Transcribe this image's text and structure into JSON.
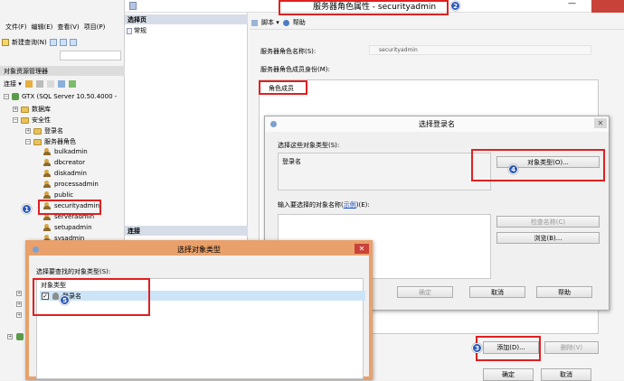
{
  "ssms": {
    "menu": [
      "文件(F)",
      "编辑(E)",
      "查看(V)",
      "项目(P)"
    ],
    "new_query": "新建查询(N)",
    "object_explorer_title": "对象资源管理器",
    "connect": "连接 ▾",
    "tree": {
      "server": "GTX (SQL Server 10.50.4000 -",
      "databases": "数据库",
      "security": "安全性",
      "logins": "登录名",
      "server_roles": "服务器角色",
      "roles": [
        "bulkadmin",
        "dbcreator",
        "diskadmin",
        "processadmin",
        "public",
        "securityadmin",
        "serveradmin",
        "setupadmin",
        "sysadmin"
      ]
    }
  },
  "role_dialog": {
    "title": "服务器角色属性 - securityadmin",
    "select_page": "选择页",
    "page_general": "常规",
    "connection": "连接",
    "toolbar": {
      "script": "脚本 ▾",
      "help": "帮助"
    },
    "role_name_label": "服务器角色名称(S):",
    "role_name_value": "securityadmin",
    "members_label": "服务器角色成员身份(M):",
    "members_header": "角色成员",
    "add": "添加(D)...",
    "remove": "删除(V)",
    "ok": "确定",
    "cancel": "取消"
  },
  "select_login": {
    "title": "选择登录名",
    "object_types_label": "选择这些对象类型(S):",
    "object_types_value": "登录名",
    "object_types_button": "对象类型(O)...",
    "names_label": "输入要选择的对象名称(",
    "names_link": "示例",
    "names_label_end": ")(E):",
    "check_names": "检查名称(C)",
    "browse": "浏览(B)...",
    "ok": "确定",
    "cancel": "取消",
    "help": "帮助"
  },
  "select_object_types": {
    "title": "选择对象类型",
    "label": "选择要查找的对象类型(S):",
    "column": "对象类型",
    "item": "登录名",
    "item_checked": true
  },
  "markers": [
    "1",
    "2",
    "3",
    "4",
    "5"
  ],
  "colors": {
    "highlight": "#e02020",
    "marker": "#2a58b8",
    "selection": "#cce4f7"
  }
}
